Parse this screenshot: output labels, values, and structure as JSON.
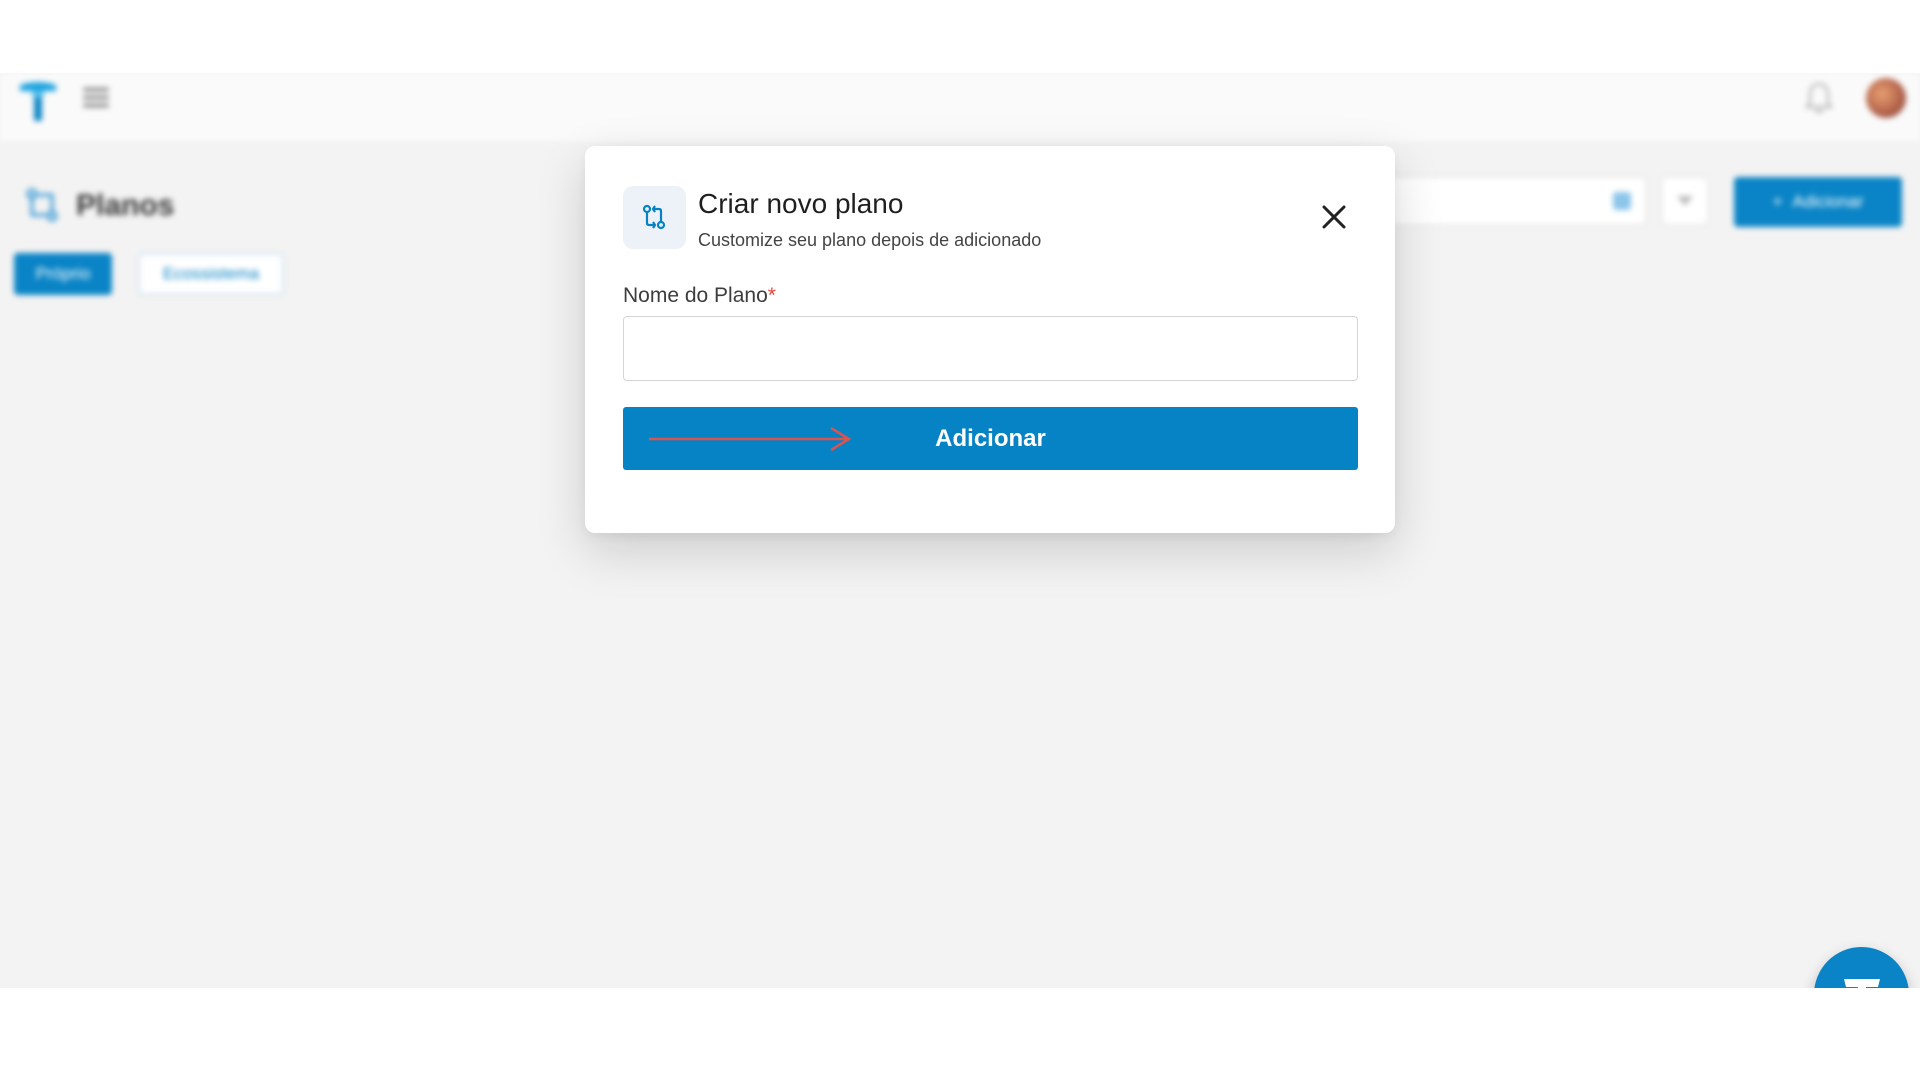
{
  "background": {
    "page_title": "Planos",
    "tabs": [
      {
        "label": "Próprio"
      },
      {
        "label": "Ecossistema"
      }
    ],
    "add_button_label": "Adicionar"
  },
  "modal": {
    "title": "Criar novo plano",
    "subtitle": "Customize seu plano depois de adicionado",
    "field_label": "Nome do Plano",
    "required_marker": "*",
    "input_value": "",
    "submit_label": "Adicionar"
  },
  "icons": {
    "logo": "logo-icon",
    "menu": "hamburger-menu-icon",
    "bell": "bell-icon",
    "plan": "git-compare-icon",
    "close": "close-icon",
    "fab": "logo-icon"
  },
  "colors": {
    "primary": "#0583c5",
    "required": "#e0473c",
    "annotation_arrow": "#d9534f"
  }
}
